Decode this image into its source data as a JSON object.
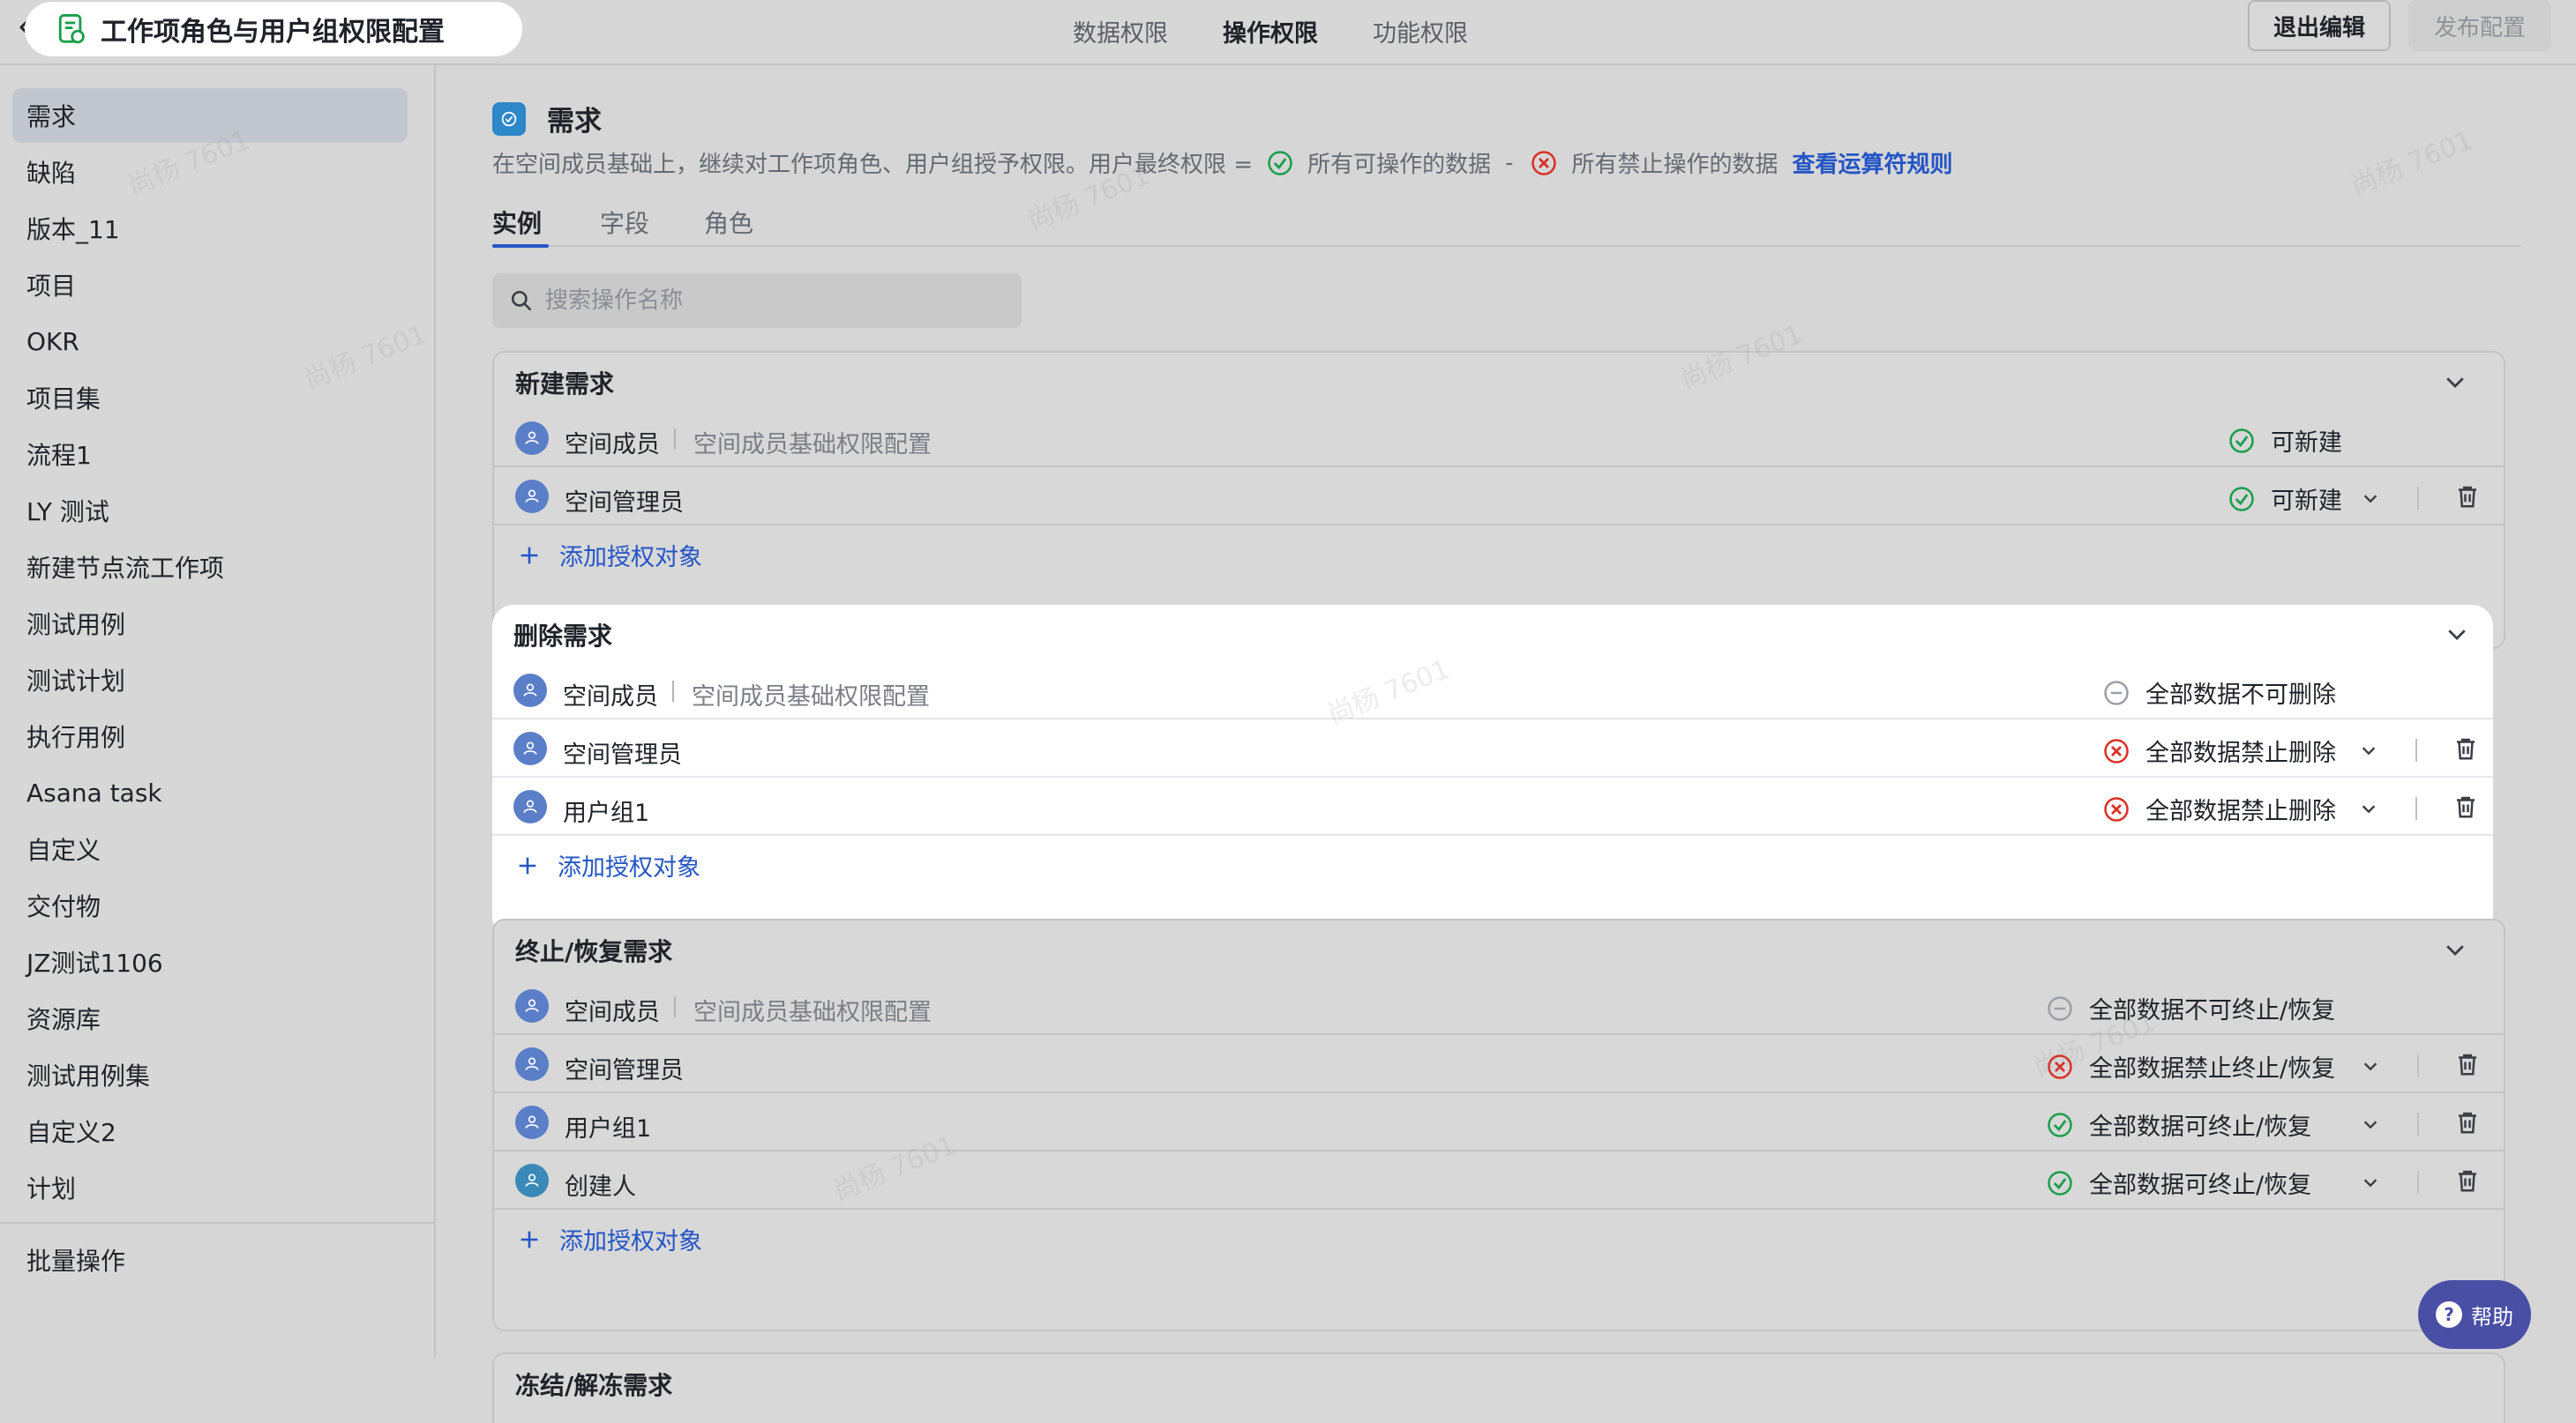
{
  "header": {
    "title": "工作项角色与用户组权限配置",
    "tabs": [
      "数据权限",
      "操作权限",
      "功能权限"
    ],
    "active_tab": "操作权限",
    "exit_button": "退出编辑",
    "publish_button": "发布配置"
  },
  "sidebar": {
    "items": [
      "需求",
      "缺陷",
      "版本_11",
      "项目",
      "OKR",
      "项目集",
      "流程1",
      "LY 测试",
      "新建节点流工作项",
      "测试用例",
      "测试计划",
      "执行用例",
      "Asana task",
      "自定义",
      "交付物",
      "JZ测试1106",
      "资源库",
      "测试用例集",
      "自定义2",
      "计划"
    ],
    "active": "需求",
    "footer_item": "批量操作"
  },
  "main": {
    "title": "需求",
    "desc_prefix": "在空间成员基础上，继续对工作项角色、用户组授予权限。用户最终权限 =",
    "desc_allowed": "所有可操作的数据",
    "desc_minus": "-",
    "desc_forbidden": "所有禁止操作的数据",
    "desc_link": "查看运算符规则",
    "tabs": [
      "实例",
      "字段",
      "角色"
    ],
    "search_placeholder": "搜索操作名称",
    "add_label": "添加授权对象",
    "sections": [
      {
        "title": "新建需求",
        "rows": [
          {
            "name": "空间成员",
            "note": "空间成员基础权限配置",
            "status": "可新建",
            "status_type": "allow"
          },
          {
            "name": "空间管理员",
            "status": "可新建",
            "status_type": "allow"
          }
        ]
      },
      {
        "title": "删除需求",
        "rows": [
          {
            "name": "空间成员",
            "note": "空间成员基础权限配置",
            "status": "全部数据不可删除",
            "status_type": "none"
          },
          {
            "name": "空间管理员",
            "status": "全部数据禁止删除",
            "status_type": "forbid"
          },
          {
            "name": "用户组1",
            "status": "全部数据禁止删除",
            "status_type": "forbid"
          }
        ]
      },
      {
        "title": "终止/恢复需求",
        "rows": [
          {
            "name": "空间成员",
            "note": "空间成员基础权限配置",
            "status": "全部数据不可终止/恢复",
            "status_type": "none"
          },
          {
            "name": "空间管理员",
            "status": "全部数据禁止终止/恢复",
            "status_type": "forbid"
          },
          {
            "name": "用户组1",
            "status": "全部数据可终止/恢复",
            "status_type": "allow"
          },
          {
            "name": "创建人",
            "status": "全部数据可终止/恢复",
            "status_type": "allow"
          }
        ]
      },
      {
        "title": "冻结/解冻需求",
        "rows": []
      }
    ]
  },
  "help": {
    "label": "帮助"
  },
  "watermark": "尚杨 7601",
  "colors": {
    "accent": "#2455c6",
    "allow": "#1a9e4b",
    "forbid": "#d93026",
    "none": "#9aa0a8",
    "avatar": "#5b7ec9"
  }
}
